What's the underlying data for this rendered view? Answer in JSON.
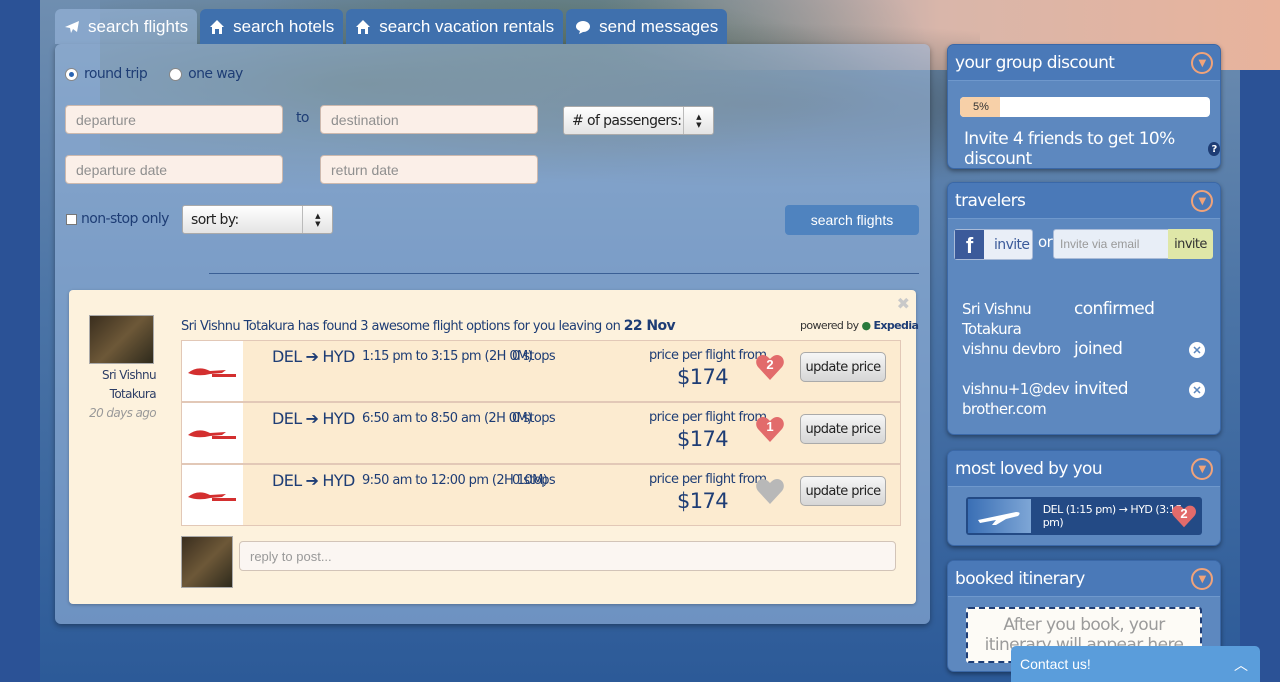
{
  "tabs": [
    {
      "label": "search flights",
      "icon": "plane-icon"
    },
    {
      "label": "search hotels",
      "icon": "home-icon"
    },
    {
      "label": "search vacation rentals",
      "icon": "home-icon"
    },
    {
      "label": "send messages",
      "icon": "chat-bubble-icon"
    }
  ],
  "search": {
    "trip_round": "round trip",
    "trip_oneway": "one way",
    "departure_placeholder": "departure",
    "to_label": "to",
    "destination_placeholder": "destination",
    "passengers_value": "# of passengers:",
    "departure_date_placeholder": "departure date",
    "return_date_placeholder": "return date",
    "nonstop_label": "non-stop only",
    "sort_value": "sort by:",
    "search_button": "search flights"
  },
  "post": {
    "poster_name_line1": "Sri Vishnu",
    "poster_name_line2": "Totakura",
    "poster_time": "20 days ago",
    "found_text": "Sri Vishnu Totakura has found 3 awesome flight options for you leaving on",
    "found_date": "22 Nov",
    "powered_by": "powered by",
    "provider": "Expedia",
    "flights": [
      {
        "from": "DEL",
        "to": "HYD",
        "times": "1:15 pm to 3:15 pm (2H 0M)",
        "stops": "0 stops",
        "price_label": "price per flight from",
        "price": "$174",
        "likes": "2",
        "update": "update price"
      },
      {
        "from": "DEL",
        "to": "HYD",
        "times": "6:50 am to 8:50 am (2H 0M)",
        "stops": "0 stops",
        "price_label": "price per flight from",
        "price": "$174",
        "likes": "1",
        "update": "update price"
      },
      {
        "from": "DEL",
        "to": "HYD",
        "times": "9:50 am to 12:00 pm (2H 10M)",
        "stops": "0 stops",
        "price_label": "price per flight from",
        "price": "$174",
        "likes": "",
        "update": "update price"
      }
    ],
    "reply_placeholder": "reply to post..."
  },
  "sidebar": {
    "discount": {
      "title": "your group discount",
      "progress_label": "5%",
      "progress_value": 0.16,
      "text": "Invite 4 friends to get 10% discount",
      "help": "?"
    },
    "travelers": {
      "title": "travelers",
      "fb_invite": "invite",
      "or": "or",
      "email_placeholder": "Invite via email",
      "invite_button": "invite",
      "list": [
        {
          "name": "Sri Vishnu Totakura",
          "status": "confirmed"
        },
        {
          "name": "vishnu devbro",
          "status": "joined"
        },
        {
          "name": "vishnu+1@devbrother.com",
          "status": "invited"
        }
      ]
    },
    "loved": {
      "title": "most loved by you",
      "item": "DEL (1:15 pm) → HYD (3:15 pm)",
      "likes": "2"
    },
    "itinerary": {
      "title": "booked itinerary",
      "empty_text": "After you book, your itinerary will appear here"
    }
  },
  "contact": {
    "label": "Contact us!"
  },
  "colors": {
    "accent": "#4f83bf",
    "heart_filled": "#e26b6b",
    "heart_empty": "#b8b8b8",
    "panel": "#5d88bf"
  }
}
